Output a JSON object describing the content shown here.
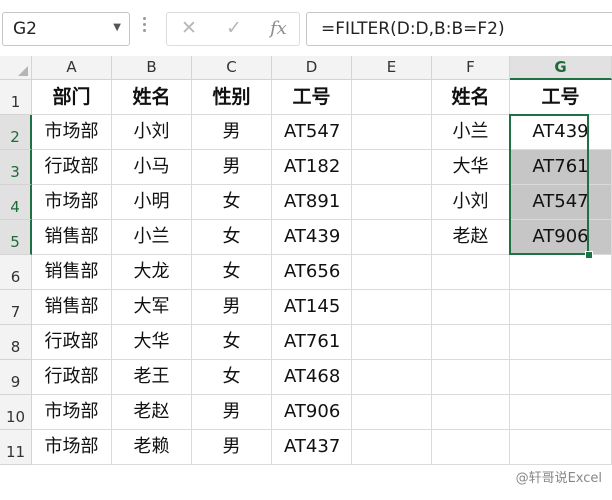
{
  "name_box": {
    "value": "G2"
  },
  "formula_bar": {
    "cancel_glyph": "✕",
    "enter_glyph": "✓",
    "fx_label": "fx",
    "formula": "=FILTER(D:D,B:B=F2)"
  },
  "columns": [
    "A",
    "B",
    "C",
    "D",
    "E",
    "F",
    "G"
  ],
  "selected_column": "G",
  "rows": [
    "1",
    "2",
    "3",
    "4",
    "5",
    "6",
    "7",
    "8",
    "9",
    "10",
    "11"
  ],
  "selected_rows": [
    "2",
    "3",
    "4",
    "5"
  ],
  "main_table": {
    "headers": [
      "部门",
      "姓名",
      "性别",
      "工号"
    ],
    "rows": [
      [
        "市场部",
        "小刘",
        "男",
        "AT547"
      ],
      [
        "行政部",
        "小马",
        "男",
        "AT182"
      ],
      [
        "市场部",
        "小明",
        "女",
        "AT891"
      ],
      [
        "销售部",
        "小兰",
        "女",
        "AT439"
      ],
      [
        "销售部",
        "大龙",
        "女",
        "AT656"
      ],
      [
        "销售部",
        "大军",
        "男",
        "AT145"
      ],
      [
        "行政部",
        "大华",
        "女",
        "AT761"
      ],
      [
        "行政部",
        "老王",
        "女",
        "AT468"
      ],
      [
        "市场部",
        "老赵",
        "男",
        "AT906"
      ],
      [
        "市场部",
        "老赖",
        "男",
        "AT437"
      ]
    ]
  },
  "lookup_table": {
    "headers": [
      "姓名",
      "工号"
    ],
    "rows": [
      [
        "小兰",
        "AT439"
      ],
      [
        "大华",
        "AT761"
      ],
      [
        "小刘",
        "AT547"
      ],
      [
        "老赵",
        "AT906"
      ]
    ]
  },
  "watermark": "@轩哥说Excel",
  "colors": {
    "selection": "#1e7145",
    "spill_fill": "#c6c6c6",
    "header_bg": "#f3f3f3"
  }
}
